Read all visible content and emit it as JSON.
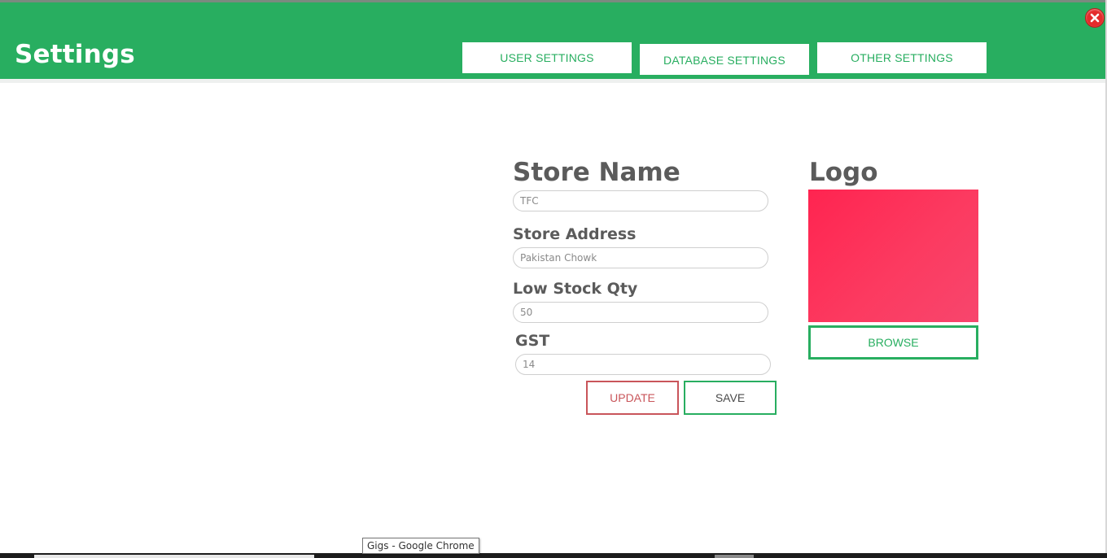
{
  "header": {
    "title": "Settings",
    "tabs": [
      {
        "label": "USER SETTINGS"
      },
      {
        "label": "DATABASE SETTINGS"
      },
      {
        "label": "OTHER SETTINGS"
      }
    ],
    "close_icon": "close-icon",
    "accent_color": "#28ae60"
  },
  "form": {
    "store_name": {
      "label": "Store Name",
      "value": "TFC"
    },
    "store_address": {
      "label": "Store Address",
      "value": "Pakistan Chowk"
    },
    "low_stock_qty": {
      "label": "Low Stock Qty",
      "value": "50"
    },
    "gst": {
      "label": "GST",
      "value": "14"
    },
    "update_label": "UPDATE",
    "save_label": "SAVE"
  },
  "logo": {
    "label": "Logo",
    "browse_label": "BROWSE",
    "preview_color": "#ff3058"
  },
  "taskbar": {
    "tooltip": "Gigs - Google Chrome"
  }
}
